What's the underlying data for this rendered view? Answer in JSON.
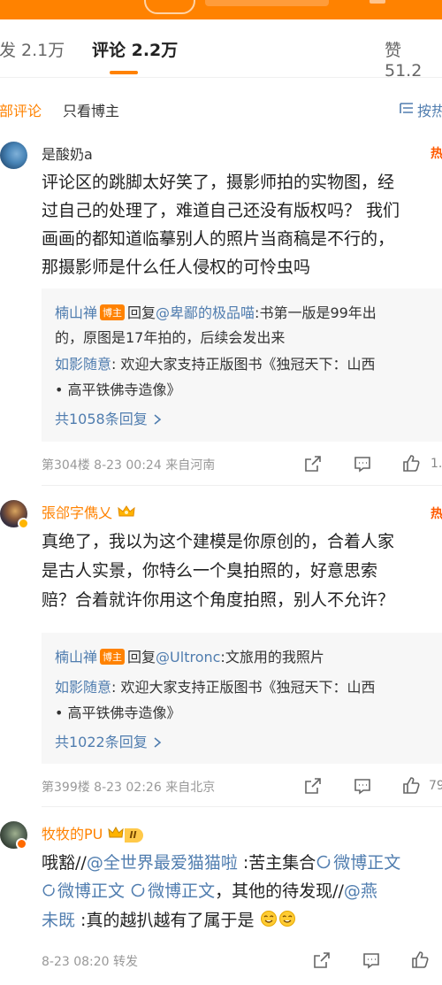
{
  "tabs": {
    "repost": "发 2.1万",
    "comment": "评论 2.2万",
    "like": "赞 51.2"
  },
  "filter": {
    "all": "部评论",
    "blogger_only": "只看博主",
    "sort": "按热"
  },
  "comments": [
    {
      "user": "是酸奶a",
      "hot": "热",
      "lines": [
        "评论区的跳脚太好笑了，摄影师拍的实物图，经",
        "过自己的处理了，难道自己还没有版权吗？ 我们",
        "画画的都知道临摹别人的照片当商稿是不行的，",
        "那摄影师是什么任人侵权的可怜虫吗"
      ],
      "reply1": {
        "user": "楠山禅",
        "badge": "博主",
        "prefix": "回复",
        "mention": "@卑鄙的极品喵",
        "text": ":书第一版是99年出",
        "cont": "的，原图是17年拍的，后续会发出来"
      },
      "reply2": {
        "user": "如影随意",
        "text": ": 欢迎大家支持正版图书《独冠天下：山西",
        "cont": "• 高平铁佛寺造像》"
      },
      "more": "共1058条回复",
      "meta": "第304楼 8-23 00:24 来自河南",
      "likes": "1."
    },
    {
      "user": "張郃字儁乂",
      "hot": "热",
      "lines": [
        "真绝了，我以为这个建模是你原创的，合着人家",
        "是古人实景，你特么一个臭拍照的，好意思索",
        "赔？合着就许你用这个角度拍照，别人不允许？"
      ],
      "reply1": {
        "user": "楠山禅",
        "badge": "博主",
        "prefix": "回复",
        "mention": "@Ultronc",
        "text": ":文旅用的我照片"
      },
      "reply2": {
        "user": "如影随意",
        "text": ": 欢迎大家支持正版图书《独冠天下：山西",
        "cont": "• 高平铁佛寺造像》"
      },
      "more": "共1022条回复",
      "meta": "第399楼 8-23 02:26 来自北京",
      "likes": "79"
    },
    {
      "user": "牧牧的PU",
      "level": "II",
      "line1_pre": "哦豁//",
      "line1_mention": "@全世界最爱猫猫啦",
      "line1_text": " :苦主集合",
      "line1_link": "微博正文",
      "line2_link1": "微博正文",
      "line2_link2": "微博正文",
      "line2_text": "，其他的待发现//",
      "line2_mention": "@燕",
      "line3_mention": "未既",
      "line3_text": " :真的越扒越有了属于是",
      "meta": "8-23 08:20 转发"
    }
  ],
  "colors": {
    "accent": "#ff8200",
    "link": "#507daf",
    "hot": "#ff5a00"
  }
}
